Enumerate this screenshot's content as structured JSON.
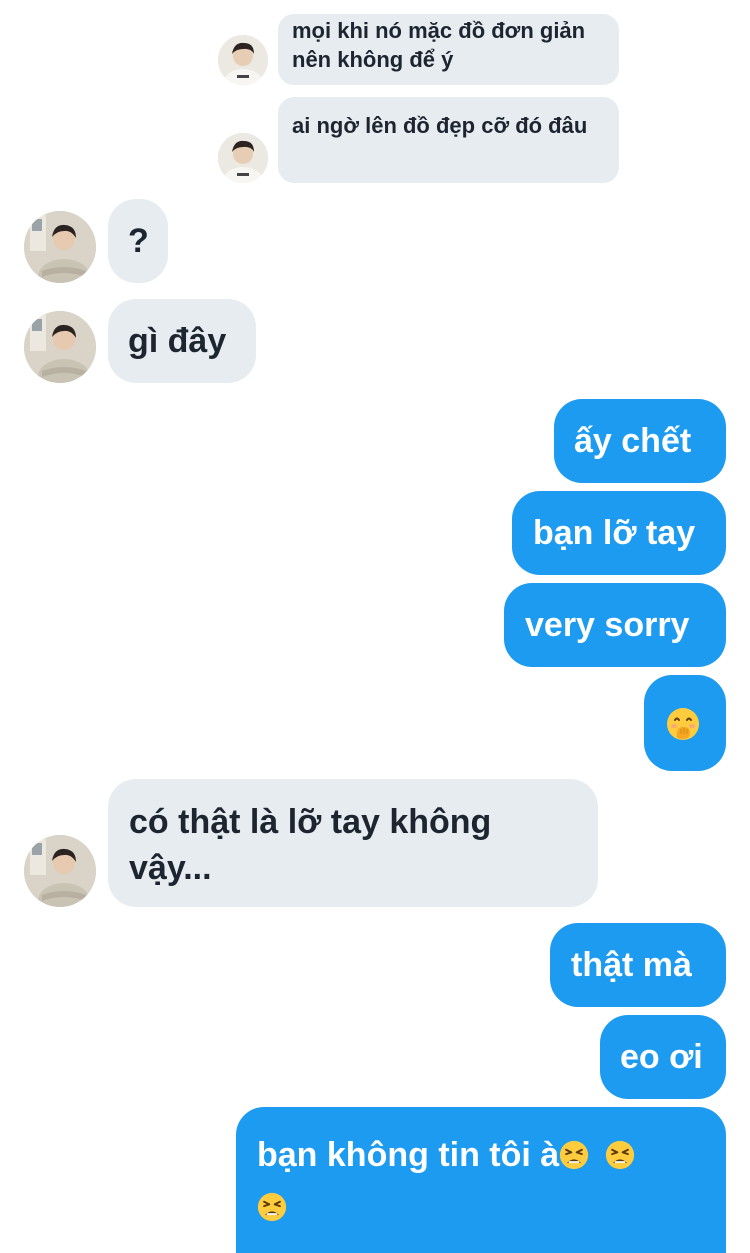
{
  "conversation": {
    "quoted": [
      {
        "text": "mọi khi nó mặc đồ đơn giản nên không để ý"
      },
      {
        "text": "ai ngờ lên đồ đẹp cỡ đó đâu"
      }
    ],
    "messages": [
      {
        "from": "them",
        "text": "?"
      },
      {
        "from": "them",
        "text": "gì đây"
      },
      {
        "from": "me",
        "text": "ấy chết"
      },
      {
        "from": "me",
        "text": "bạn lỡ tay"
      },
      {
        "from": "me",
        "text": "very sorry"
      },
      {
        "from": "me",
        "emoji": "face-with-hand-over-mouth-icon"
      },
      {
        "from": "them",
        "text": "có thật là lỡ tay không vậy..."
      },
      {
        "from": "me",
        "text": "thật mà"
      },
      {
        "from": "me",
        "text": "eo ơi"
      },
      {
        "from": "me",
        "text": "bạn không tin tôi à",
        "emoji": "tired-face-icon",
        "emoji_count": 3
      }
    ]
  },
  "colors": {
    "incoming_bubble": "#e7ecf1",
    "outgoing_bubble": "#1d9bf0",
    "incoming_text": "#1d2630",
    "outgoing_text": "#ffffff"
  }
}
